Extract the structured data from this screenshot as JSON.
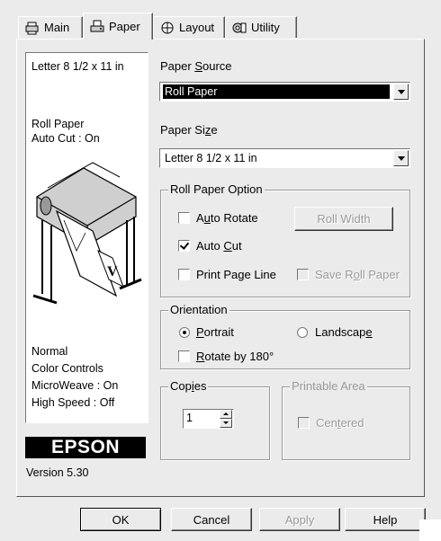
{
  "tabs": [
    {
      "label": "Main",
      "icon": "main-tab-icon"
    },
    {
      "label": "Paper",
      "icon": "paper-tab-icon"
    },
    {
      "label": "Layout",
      "icon": "layout-tab-icon"
    },
    {
      "label": "Utility",
      "icon": "utility-tab-icon"
    }
  ],
  "info": {
    "paper_size": "Letter 8 1/2 x 11 in",
    "source": "Roll Paper",
    "auto_cut": "Auto Cut : On",
    "mode": "Normal",
    "color": "Color Controls",
    "microweave": "MicroWeave : On",
    "high_speed": "High Speed : Off",
    "logo": "EPSON",
    "version": "Version 5.30"
  },
  "paper_source": {
    "label_pre": "Paper ",
    "label_key": "S",
    "label_post": "ource",
    "value": "Roll Paper"
  },
  "paper_size": {
    "label_pre": "Paper Si",
    "label_key": "z",
    "label_post": "e",
    "value": "Letter 8 1/2 x 11 in"
  },
  "roll_option": {
    "title": "Roll Paper Option",
    "auto_rotate": {
      "pre": "A",
      "key": "u",
      "post": "to Rotate",
      "checked": false
    },
    "roll_width": "Roll Width",
    "auto_cut": {
      "pre": "Auto ",
      "key": "C",
      "post": "ut",
      "checked": true
    },
    "print_page_line": {
      "label": "Print Page Line",
      "checked": false
    },
    "save_roll_paper": {
      "pre": "Save R",
      "key": "o",
      "post": "ll Paper",
      "checked": false
    }
  },
  "orientation": {
    "title": "Orientation",
    "portrait": {
      "pre": "",
      "key": "P",
      "post": "ortrait",
      "selected": true
    },
    "landscape": {
      "pre": "Landscap",
      "key": "e",
      "post": "",
      "selected": false
    },
    "rotate180": {
      "pre": "",
      "key": "R",
      "post": "otate by 180°",
      "checked": false
    }
  },
  "copies": {
    "title_pre": "Cop",
    "title_key": "i",
    "title_post": "es",
    "value": "1"
  },
  "printable_area": {
    "title": "Printable Area",
    "centered_pre": "Cen",
    "centered_key": "t",
    "centered_post": "ered",
    "checked": false
  },
  "buttons": {
    "ok": "OK",
    "cancel": "Cancel",
    "apply": "Apply",
    "help": "Help"
  }
}
